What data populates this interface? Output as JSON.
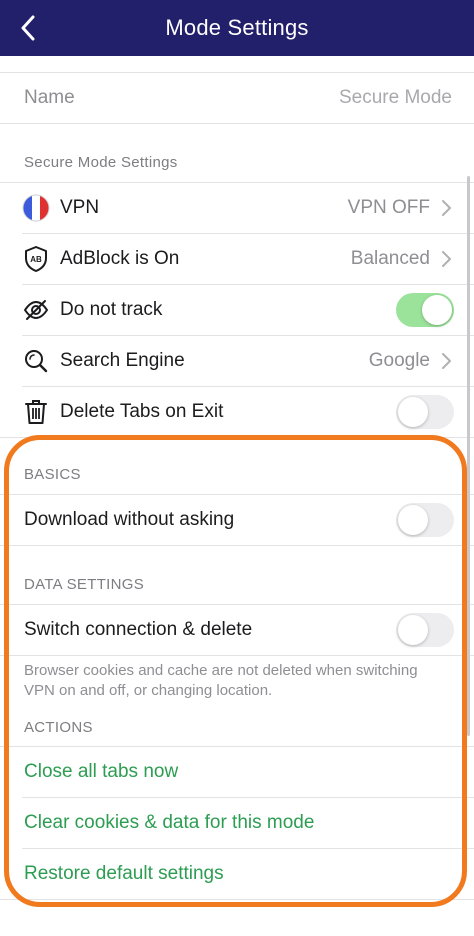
{
  "header": {
    "title": "Mode Settings",
    "back_icon": "chevron-left-icon"
  },
  "name_row": {
    "label": "Name",
    "placeholder": "Secure Mode"
  },
  "secure_section": {
    "title": "Secure Mode Settings",
    "items": [
      {
        "icon": "france-flag-icon",
        "label": "VPN",
        "value": "VPN OFF"
      },
      {
        "icon": "adblock-shield-icon",
        "label": "AdBlock is On",
        "value": "Balanced"
      },
      {
        "icon": "eye-crossed-icon",
        "label": "Do not track",
        "toggle": true
      },
      {
        "icon": "search-magnifier-icon",
        "label": "Search Engine",
        "value": "Google"
      },
      {
        "icon": "trash-icon",
        "label": "Delete Tabs on Exit",
        "toggle": false
      }
    ]
  },
  "basics": {
    "title": "BASICS",
    "download_label": "Download without asking",
    "download_toggle": false
  },
  "data_settings": {
    "title": "DATA SETTINGS",
    "switch_label": "Switch connection & delete",
    "switch_toggle": false,
    "note": "Browser cookies and cache are not deleted when switching VPN on and off, or changing location."
  },
  "actions": {
    "title": "ACTIONS",
    "close_tabs": "Close all tabs now",
    "clear_cookies": "Clear cookies & data for this mode",
    "restore_defaults": "Restore default settings"
  },
  "colors": {
    "navbar": "#221f6b",
    "action_green": "#2d9d52",
    "toggle_on": "#9be39b",
    "highlight_orange": "#f07a1d"
  }
}
